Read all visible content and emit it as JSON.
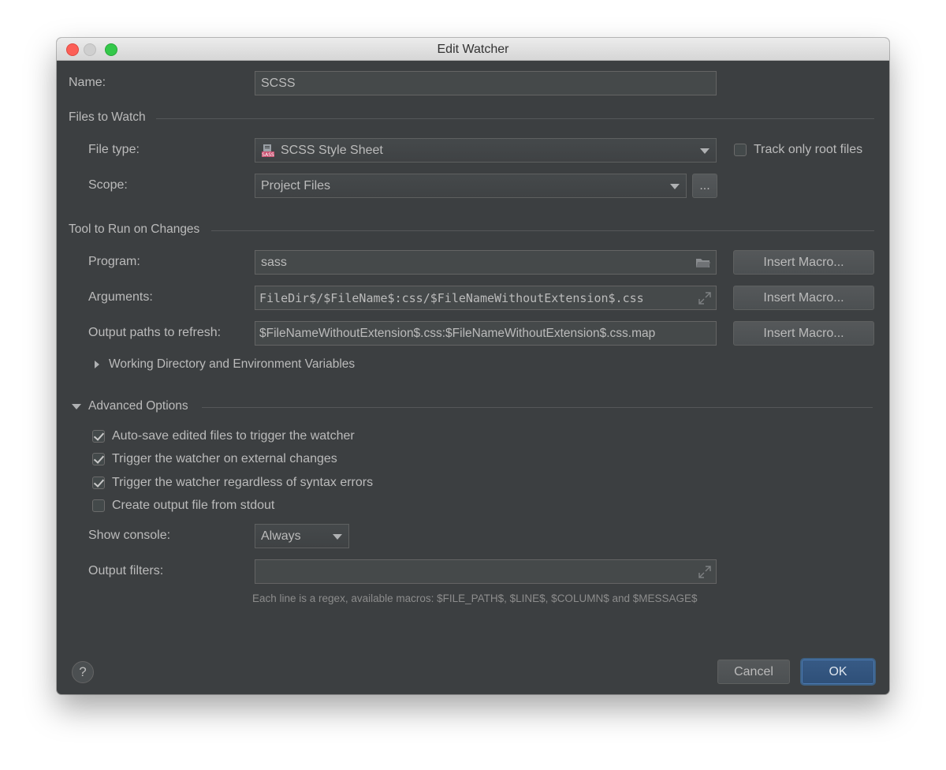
{
  "window": {
    "title": "Edit Watcher"
  },
  "name": {
    "label": "Name:",
    "value": "SCSS"
  },
  "files_to_watch": {
    "section": "Files to Watch",
    "file_type": {
      "label": "File type:",
      "value": "SCSS Style Sheet",
      "icon": "sass-file-icon"
    },
    "track_root": {
      "label": "Track only root files",
      "checked": false
    },
    "scope": {
      "label": "Scope:",
      "value": "Project Files",
      "browse_label": "..."
    }
  },
  "tool": {
    "section": "Tool to Run on Changes",
    "program": {
      "label": "Program:",
      "value": "sass",
      "macro": "Insert Macro..."
    },
    "arguments": {
      "label": "Arguments:",
      "value": "FileDir$/$FileName$:css/$FileNameWithoutExtension$.css",
      "macro": "Insert Macro..."
    },
    "output_paths": {
      "label": "Output paths to refresh:",
      "value": "$FileNameWithoutExtension$.css:$FileNameWithoutExtension$.css.map",
      "macro": "Insert Macro..."
    },
    "working_dir": "Working Directory and Environment Variables"
  },
  "advanced": {
    "section": "Advanced Options",
    "options": [
      {
        "label": "Auto-save edited files to trigger the watcher",
        "checked": true
      },
      {
        "label": "Trigger the watcher on external changes",
        "checked": true
      },
      {
        "label": "Trigger the watcher regardless of syntax errors",
        "checked": true
      },
      {
        "label": "Create output file from stdout",
        "checked": false
      }
    ],
    "show_console": {
      "label": "Show console:",
      "value": "Always"
    },
    "output_filters": {
      "label": "Output filters:",
      "value": ""
    },
    "hint": "Each line is a regex, available macros: $FILE_PATH$, $LINE$, $COLUMN$ and $MESSAGE$"
  },
  "footer": {
    "help": "?",
    "cancel": "Cancel",
    "ok": "OK"
  },
  "colors": {
    "background": "#3c3f41",
    "accent": "#375a85",
    "field": "#45494a"
  }
}
